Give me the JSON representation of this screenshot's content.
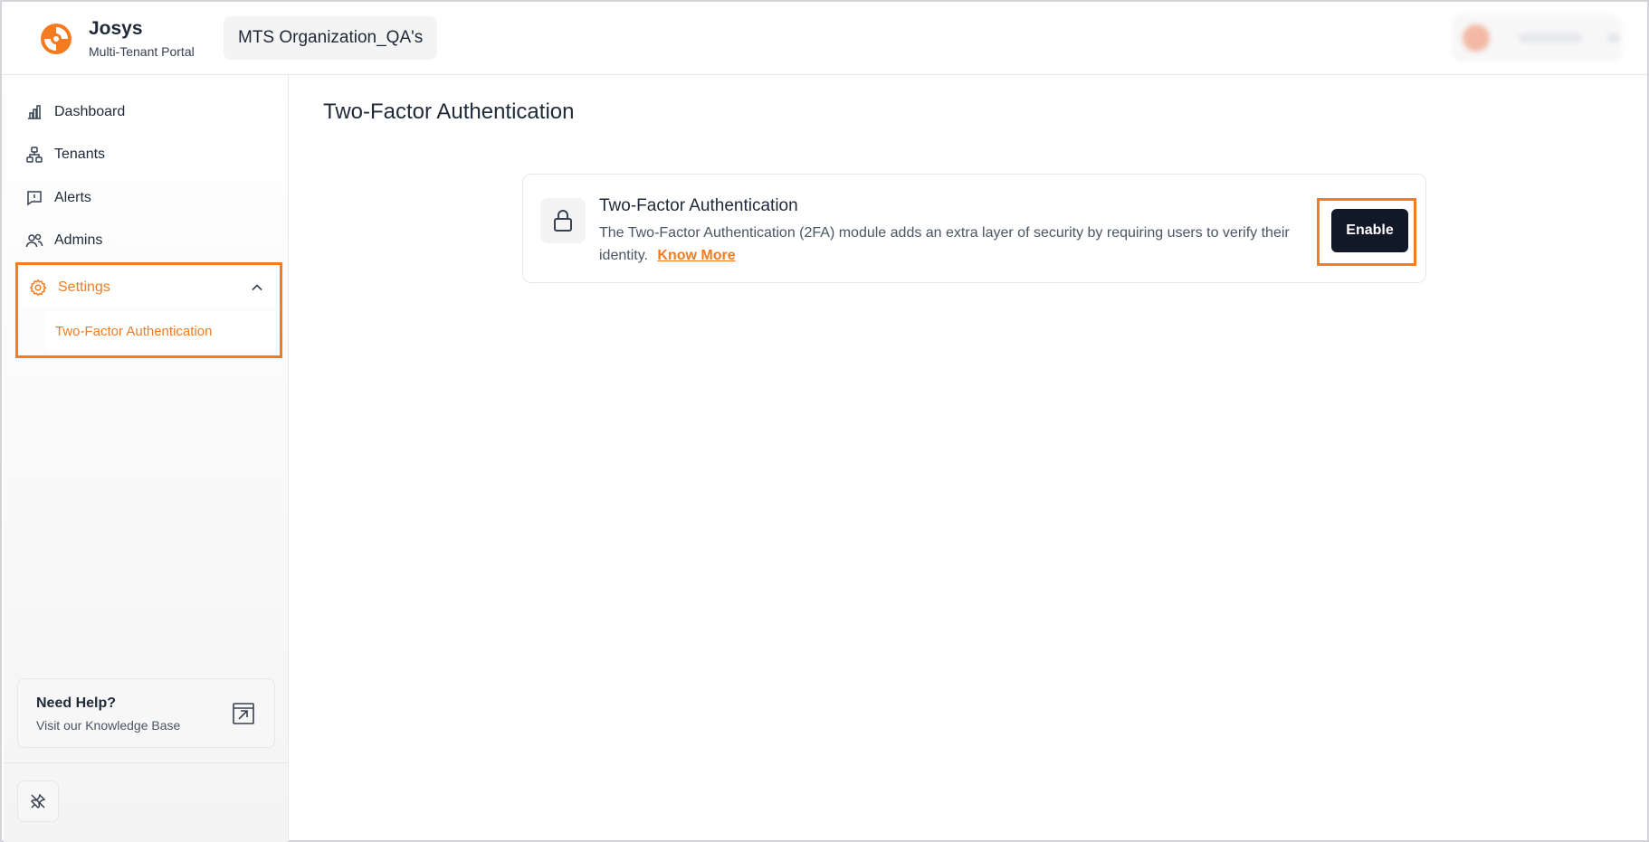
{
  "header": {
    "brand_name": "Josys",
    "brand_sub": "Multi-Tenant Portal",
    "org_name": "MTS Organization_QA's",
    "brand_color": "#f47b20"
  },
  "sidebar": {
    "items": [
      {
        "label": "Dashboard",
        "icon": "bar-chart-icon"
      },
      {
        "label": "Tenants",
        "icon": "hierarchy-icon"
      },
      {
        "label": "Alerts",
        "icon": "message-alert-icon"
      },
      {
        "label": "Admins",
        "icon": "users-icon"
      },
      {
        "label": "Settings",
        "icon": "gear-icon",
        "expanded": true
      }
    ],
    "subitems": [
      {
        "label": "Two-Factor Authentication",
        "active": true
      }
    ],
    "help": {
      "title": "Need Help?",
      "subtitle": "Visit our Knowledge Base"
    }
  },
  "main": {
    "page_title": "Two-Factor Authentication",
    "card": {
      "title": "Two-Factor Authentication",
      "description": "The Two-Factor Authentication (2FA) module adds an extra layer of security by requiring users to verify their identity.",
      "link_label": "Know More",
      "button_label": "Enable"
    }
  },
  "colors": {
    "accent": "#f47b20",
    "button_dark": "#111827"
  }
}
